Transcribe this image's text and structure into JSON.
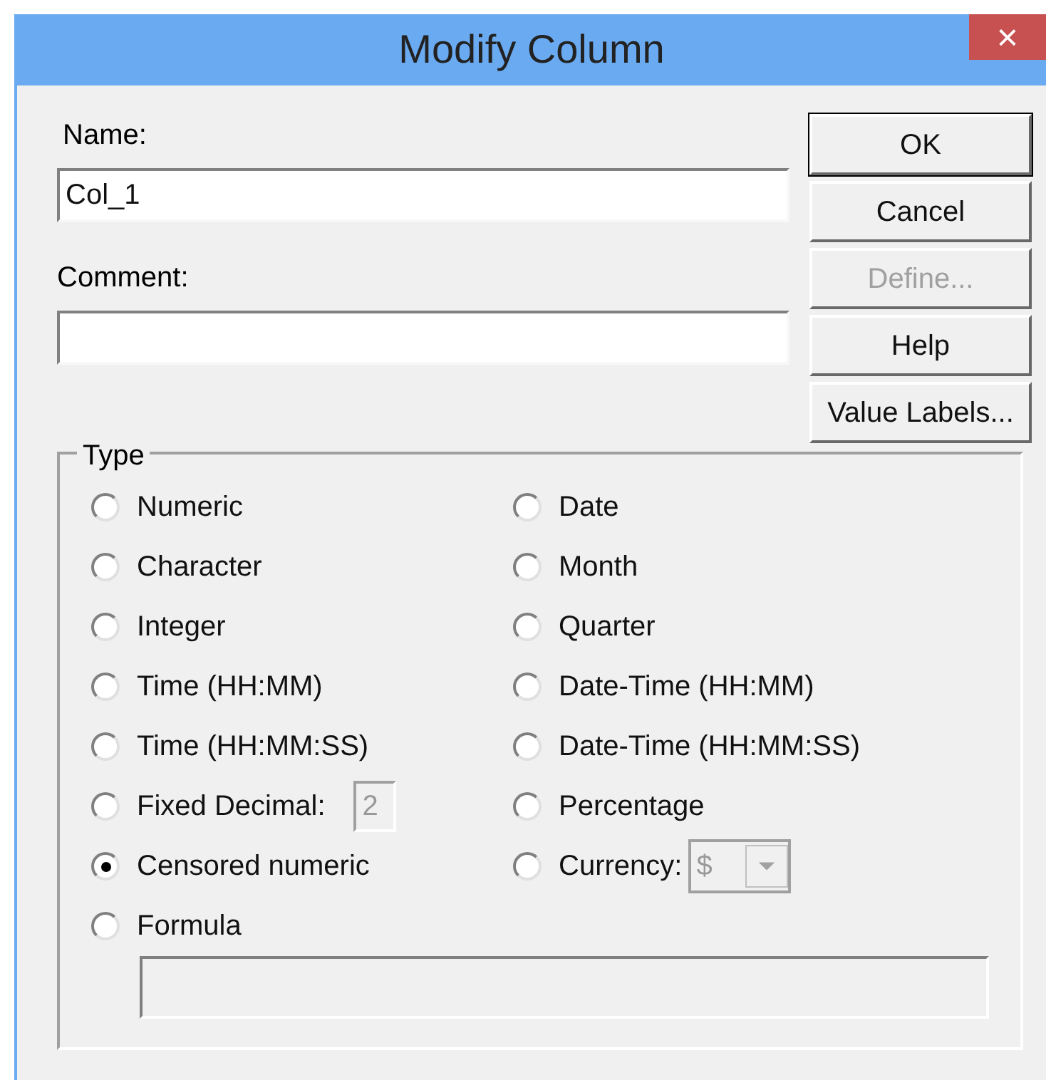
{
  "window": {
    "title": "Modify Column",
    "close": "×"
  },
  "name": {
    "label": "Name:",
    "value": "Col_1"
  },
  "comment": {
    "label": "Comment:"
  },
  "buttons": [
    {
      "label": "OK",
      "default": true,
      "disabled": false
    },
    {
      "label": "Cancel",
      "default": false,
      "disabled": false
    },
    {
      "label": "Define...",
      "default": false,
      "disabled": true
    },
    {
      "label": "Help",
      "default": false,
      "disabled": false
    },
    {
      "label": "Value Labels...",
      "default": false,
      "disabled": false
    }
  ],
  "type_group": {
    "title": "Type",
    "left_options": [
      {
        "label": "Numeric",
        "selected": false,
        "kind": "plain"
      },
      {
        "label": "Character",
        "selected": false,
        "kind": "plain"
      },
      {
        "label": "Integer",
        "selected": false,
        "kind": "plain"
      },
      {
        "label": "Time (HH:MM)",
        "selected": false,
        "kind": "plain"
      },
      {
        "label": "Time (HH:MM:SS)",
        "selected": false,
        "kind": "plain"
      },
      {
        "label": "Fixed Decimal:",
        "selected": false,
        "kind": "field",
        "value": "2"
      },
      {
        "label": "Censored numeric",
        "selected": true,
        "kind": "plain"
      },
      {
        "label": "Formula",
        "selected": false,
        "kind": "plain"
      }
    ],
    "right_options": [
      {
        "label": "Date",
        "selected": false,
        "kind": "plain"
      },
      {
        "label": "Month",
        "selected": false,
        "kind": "plain"
      },
      {
        "label": "Quarter",
        "selected": false,
        "kind": "plain"
      },
      {
        "label": "Date-Time (HH:MM)",
        "selected": false,
        "kind": "plain"
      },
      {
        "label": "Date-Time (HH:MM:SS)",
        "selected": false,
        "kind": "plain"
      },
      {
        "label": "Percentage",
        "selected": false,
        "kind": "plain"
      },
      {
        "label": "Currency:",
        "selected": false,
        "kind": "dropdown",
        "value": "$"
      }
    ],
    "formula": {
      "disabled": true
    }
  }
}
